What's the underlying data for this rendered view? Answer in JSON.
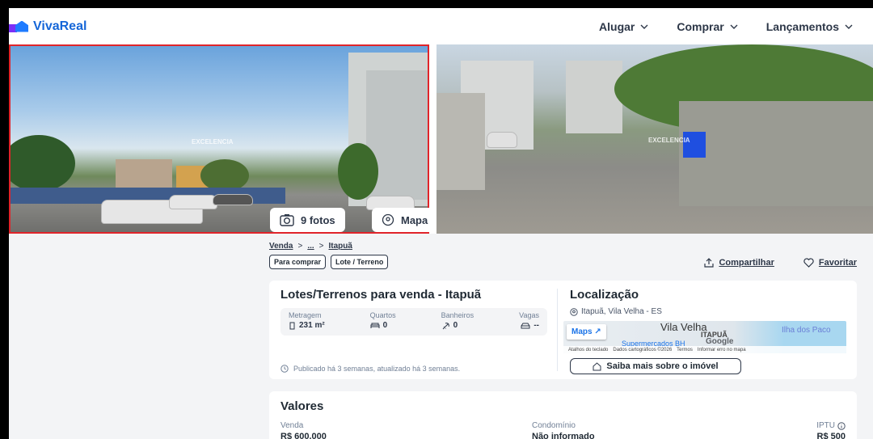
{
  "header": {
    "logo_text": "VivaReal",
    "nav": [
      {
        "label": "Alugar"
      },
      {
        "label": "Comprar"
      },
      {
        "label": "Lançamentos"
      }
    ]
  },
  "photos": {
    "fotos_label": "9 fotos",
    "mapa_label": "Mapa",
    "watermark": "EXCELENCIA"
  },
  "breadcrumb": [
    "Venda",
    "...",
    "Itapuã"
  ],
  "tags": [
    "Para comprar",
    "Lote / Terreno"
  ],
  "actions": {
    "share": "Compartilhar",
    "favorite": "Favoritar"
  },
  "listing": {
    "title": "Lotes/Terrenos para venda - Itapuã",
    "stats": [
      {
        "label": "Metragem",
        "value": "231 m²",
        "icon": "ruler-icon"
      },
      {
        "label": "Quartos",
        "value": "0",
        "icon": "bed-icon"
      },
      {
        "label": "Banheiros",
        "value": "0",
        "icon": "shower-icon"
      },
      {
        "label": "Vagas",
        "value": "--",
        "icon": "car-icon"
      }
    ],
    "published": "Publicado há 3 semanas, atualizado há 3 semanas."
  },
  "location": {
    "title": "Localização",
    "address": "Itapuã, Vila Velha - ES",
    "map": {
      "button": "Maps",
      "city": "Vila Velha",
      "area": "ITAPUÃ",
      "isle": "Ilha dos Paco",
      "poi": "Supermercados BH",
      "google": "Google",
      "footer": [
        "Atalhos do teclado",
        "Dados cartográficos ©2026",
        "Termos",
        "Informar erro no mapa"
      ]
    },
    "saiba_mais": "Saiba mais sobre o imóvel"
  },
  "valores": {
    "title": "Valores",
    "venda_label": "Venda",
    "venda_value": "R$ 600.000",
    "condominio_label": "Condomínio",
    "condominio_value": "Não informado",
    "iptu_label": "IPTU",
    "iptu_value": "R$ 500"
  },
  "colors": {
    "brand": "#1566d8",
    "photo_border": "#e0242a"
  }
}
